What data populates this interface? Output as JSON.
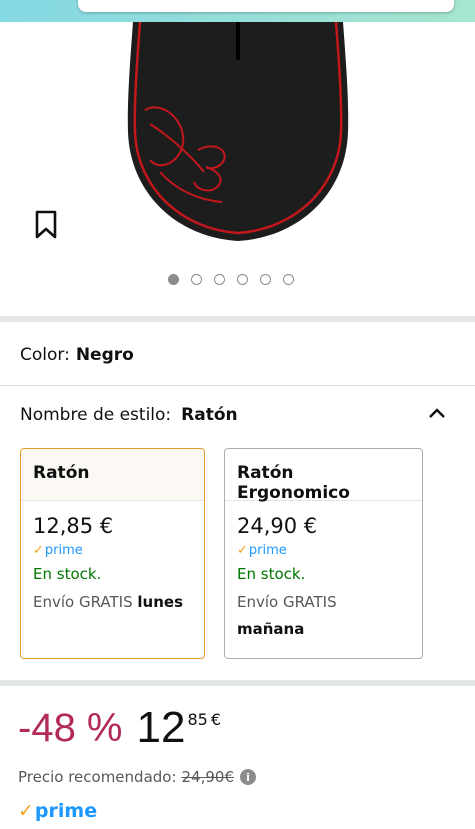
{
  "colors": {
    "accent": "#e29a2a",
    "discount": "#b12a5b",
    "stock": "#007600",
    "prime": "#1a98ff",
    "check": "#f0a21c"
  },
  "gallery": {
    "image_alt": "Ratón gaming negro con logotipo rojo",
    "image_count": 6,
    "active_index": 0
  },
  "icons": {
    "bookmark": "bookmark-icon",
    "chevron": "chevron-up-icon",
    "info": "info-icon",
    "prime_check": "check-icon"
  },
  "color_section": {
    "label": "Color:",
    "value": "Negro"
  },
  "style_section": {
    "label": "Nombre de estilo:",
    "value": "Ratón"
  },
  "options": [
    {
      "name": "Ratón",
      "price": "12,85 €",
      "prime": "prime",
      "stock": "En stock.",
      "shipping_prefix": "Envío GRATIS",
      "shipping_day": "lunes",
      "selected": true
    },
    {
      "name": "Ratón Ergonomico",
      "price": "24,90 €",
      "prime": "prime",
      "stock": "En stock.",
      "shipping_prefix": "Envío GRATIS",
      "shipping_day": "mañana",
      "selected": false
    }
  ],
  "pricing": {
    "discount": "-48 %",
    "whole": "12",
    "fraction": "85",
    "currency": "€",
    "rrp_label": "Precio recomendado:",
    "rrp_value": "24,90€",
    "prime": "prime"
  }
}
